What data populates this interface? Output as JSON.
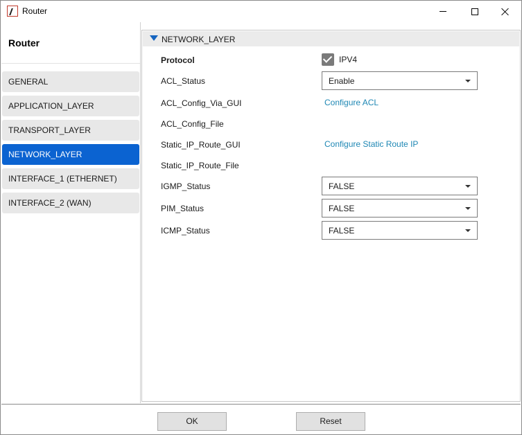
{
  "window": {
    "title": "Router",
    "icon": "app-logo-icon"
  },
  "sidebar": {
    "title": "Router",
    "items": [
      {
        "label": "GENERAL",
        "active": false
      },
      {
        "label": "APPLICATION_LAYER",
        "active": false
      },
      {
        "label": "TRANSPORT_LAYER",
        "active": false
      },
      {
        "label": "NETWORK_LAYER",
        "active": true
      },
      {
        "label": "INTERFACE_1 (ETHERNET)",
        "active": false
      },
      {
        "label": "INTERFACE_2 (WAN)",
        "active": false
      }
    ]
  },
  "section": {
    "title": "NETWORK_LAYER",
    "icon": "triangle-down-icon"
  },
  "fields": {
    "protocol": {
      "label": "Protocol",
      "checkbox_label": "IPV4",
      "checked": true
    },
    "acl_status": {
      "label": "ACL_Status",
      "value": "Enable"
    },
    "acl_config_gui": {
      "label": "ACL_Config_Via_GUI",
      "link": "Configure ACL"
    },
    "acl_config_file": {
      "label": "ACL_Config_File"
    },
    "static_route_gui": {
      "label": "Static_IP_Route_GUI",
      "link": "Configure Static Route IP"
    },
    "static_route_file": {
      "label": "Static_IP_Route_File"
    },
    "igmp_status": {
      "label": "IGMP_Status",
      "value": "FALSE"
    },
    "pim_status": {
      "label": "PIM_Status",
      "value": "FALSE"
    },
    "icmp_status": {
      "label": "ICMP_Status",
      "value": "FALSE"
    }
  },
  "footer": {
    "ok_label": "OK",
    "reset_label": "Reset"
  },
  "colors": {
    "accent": "#0b63d1",
    "link": "#1e87b4",
    "logo": "#c0392b"
  }
}
